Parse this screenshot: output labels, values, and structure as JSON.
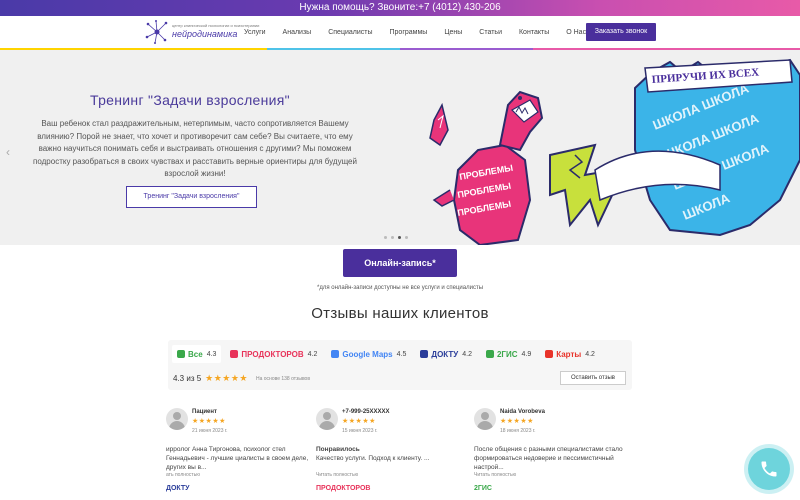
{
  "topbar": {
    "text": "Нужна помощь? Звоните:+7 (4012) 430-206"
  },
  "logo": {
    "small": "центр клинической психологии и психотерапии",
    "name": "нейродинамика"
  },
  "nav": [
    {
      "label": "Услуги"
    },
    {
      "label": "Анализы"
    },
    {
      "label": "Специалисты"
    },
    {
      "label": "Программы"
    },
    {
      "label": "Цены"
    },
    {
      "label": "Статьи"
    },
    {
      "label": "Контакты"
    },
    {
      "label": "О Нас"
    }
  ],
  "header": {
    "callback_label": "Заказать звонок"
  },
  "colors": {
    "accent": "#4a2f9c",
    "divider": [
      "#ffd400",
      "#ffd400",
      "#4fc3e8",
      "#9a5cd0",
      "#e85aa8",
      "#e85aa8"
    ]
  },
  "hero": {
    "title": "Тренинг \"Задачи взросления\"",
    "text": "Ваш ребенок стал раздражительным, нетерпимым, часто сопротивляется Вашему влиянию? Порой не знает, что хочет и противоречит сам себе? Вы считаете, что ему важно научиться понимать себя и выстраивать отношения с другими? Мы поможем подростку разобраться в своих чувствах и расставить верные ориентиры для будущей взрослой жизни!",
    "button": "Тренинг \"Задачи взросления\"",
    "prev_icon": "chevron-left-icon",
    "next_icon": "chevron-right-icon",
    "slides_total": 4,
    "slide_active": 3,
    "art": {
      "banner": "ПРИРУЧИ ИХ ВСЕХ",
      "word_left": "ПРОБЛЕМЫ",
      "word_right": "ШКОЛА"
    }
  },
  "booking": {
    "button": "Онлайн-запись*",
    "note": "*для онлайн-записи доступны не все услуги и специалисты"
  },
  "reviews": {
    "title": "Отзывы наших клиентов",
    "sources": [
      {
        "name": "Все",
        "value": "4.3",
        "color": "#3aa84a",
        "selected": true
      },
      {
        "name": "ПРОДОКТОРОВ",
        "value": "4.2",
        "color": "#e8335a",
        "selected": false
      },
      {
        "name": "Google Maps",
        "value": "4.5",
        "color": "#4285f4",
        "selected": false
      },
      {
        "name": "ДОКТУ",
        "value": "4.2",
        "color": "#2a3d9a",
        "selected": false
      },
      {
        "name": "2ГИС",
        "value": "4.9",
        "color": "#3aa84a",
        "selected": false
      },
      {
        "name": "Карты",
        "value": "4.2",
        "color": "#e8332a",
        "selected": false
      }
    ],
    "rating_text": "4.3 из 5",
    "rating_stars": "★★★★★",
    "rating_count": "На основе 138 отзывов",
    "leave_button": "Оставить отзыв",
    "items": [
      {
        "name": "Пациент",
        "stars": "★★★★★",
        "date": "21 июня 2023 г.",
        "headline": "",
        "text": "ирролог Анна Тиргонова, психолог стел Геннадьевич - лучшие циалисты в своем деле, других вы в...",
        "more": "ать полностью",
        "source": "ДОКТУ",
        "source_color": "#2a3d9a"
      },
      {
        "name": "+7-999-25XXXXX",
        "stars": "★★★★★",
        "date": "15 июня 2023 г.",
        "headline": "Понравилось",
        "text": "Качество услуги. Подход к клиенту. ...",
        "more": "Читать полностью",
        "source": "ПРОДОКТОРОВ",
        "source_color": "#e8335a"
      },
      {
        "name": "Naida Vorobeva",
        "stars": "★★★★★",
        "date": "18 июня 2023 г.",
        "headline": "",
        "text": "После общения с разными специалистами стало формироваться недоверие и пессимистичный настрой...",
        "more": "Читать полностью",
        "source": "2ГИС",
        "source_color": "#3aa84a"
      }
    ]
  },
  "fab": {
    "icon": "phone-icon"
  }
}
